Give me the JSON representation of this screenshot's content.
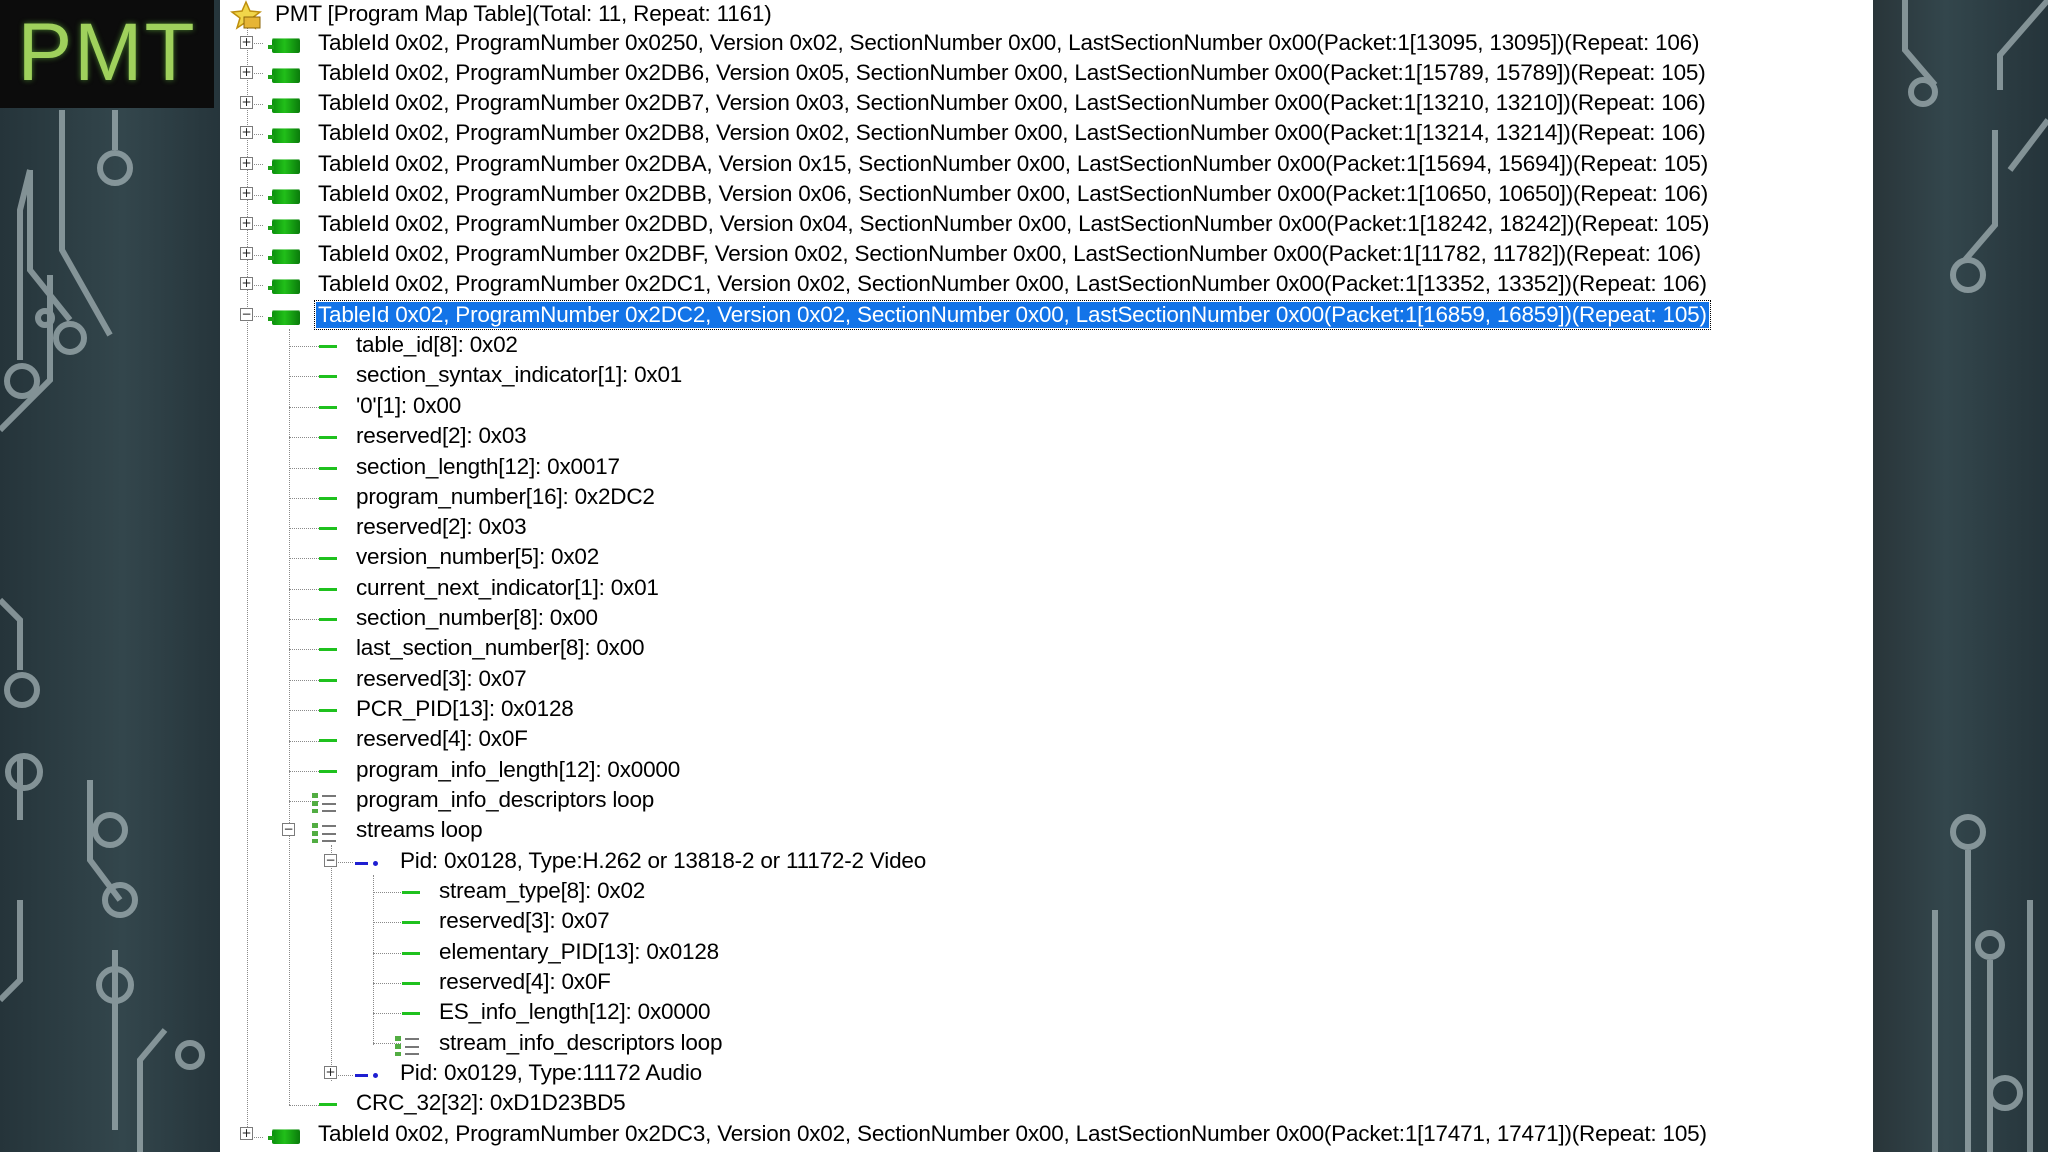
{
  "header": {
    "title": "PMT"
  },
  "tree": {
    "root": {
      "label": "PMT [Program Map Table](Total: 11, Repeat: 1161)",
      "icon": "star-folder-icon"
    },
    "tables": [
      "TableId 0x02, ProgramNumber 0x0250, Version 0x02, SectionNumber 0x00, LastSectionNumber 0x00(Packet:1[13095, 13095])(Repeat: 106)",
      "TableId 0x02, ProgramNumber 0x2DB6, Version 0x05, SectionNumber 0x00, LastSectionNumber 0x00(Packet:1[15789, 15789])(Repeat: 105)",
      "TableId 0x02, ProgramNumber 0x2DB7, Version 0x03, SectionNumber 0x00, LastSectionNumber 0x00(Packet:1[13210, 13210])(Repeat: 106)",
      "TableId 0x02, ProgramNumber 0x2DB8, Version 0x02, SectionNumber 0x00, LastSectionNumber 0x00(Packet:1[13214, 13214])(Repeat: 106)",
      "TableId 0x02, ProgramNumber 0x2DBA, Version 0x15, SectionNumber 0x00, LastSectionNumber 0x00(Packet:1[15694, 15694])(Repeat: 105)",
      "TableId 0x02, ProgramNumber 0x2DBB, Version 0x06, SectionNumber 0x00, LastSectionNumber 0x00(Packet:1[10650, 10650])(Repeat: 106)",
      "TableId 0x02, ProgramNumber 0x2DBD, Version 0x04, SectionNumber 0x00, LastSectionNumber 0x00(Packet:1[18242, 18242])(Repeat: 105)",
      "TableId 0x02, ProgramNumber 0x2DBF, Version 0x02, SectionNumber 0x00, LastSectionNumber 0x00(Packet:1[11782, 11782])(Repeat: 106)",
      "TableId 0x02, ProgramNumber 0x2DC1, Version 0x02, SectionNumber 0x00, LastSectionNumber 0x00(Packet:1[13352, 13352])(Repeat: 106)"
    ],
    "selected_table": {
      "label": "TableId 0x02, ProgramNumber 0x2DC2, Version 0x02, SectionNumber 0x00, LastSectionNumber 0x00(Packet:1[16859, 16859])(Repeat: 105)",
      "fields": [
        "table_id[8]: 0x02",
        "section_syntax_indicator[1]: 0x01",
        "'0'[1]: 0x00",
        "reserved[2]: 0x03",
        "section_length[12]: 0x0017",
        "program_number[16]: 0x2DC2",
        "reserved[2]: 0x03",
        "version_number[5]: 0x02",
        "current_next_indicator[1]: 0x01",
        "section_number[8]: 0x00",
        "last_section_number[8]: 0x00",
        "reserved[3]: 0x07",
        "PCR_PID[13]: 0x0128",
        "reserved[4]: 0x0F",
        "program_info_length[12]: 0x0000"
      ],
      "program_info_loop": "program_info_descriptors loop",
      "streams_loop": "streams loop",
      "stream_video": {
        "label": "Pid: 0x0128, Type:H.262 or 13818-2 or 11172-2 Video",
        "fields": [
          "stream_type[8]: 0x02",
          "reserved[3]: 0x07",
          "elementary_PID[13]: 0x0128",
          "reserved[4]: 0x0F",
          "ES_info_length[12]: 0x0000"
        ],
        "descriptor_loop": "stream_info_descriptors loop"
      },
      "stream_audio": "Pid: 0x0129, Type:11172 Audio",
      "crc": "CRC_32[32]: 0xD1D23BD5"
    },
    "last_table": "TableId 0x02, ProgramNumber 0x2DC3, Version 0x02, SectionNumber 0x00, LastSectionNumber 0x00(Packet:1[17471, 17471])(Repeat: 105)"
  },
  "colors": {
    "title_green": "#9FD15C",
    "selection_blue": "#1374E8",
    "table_icon_green": "#1CA016",
    "stream_icon_blue": "#1F1FD1"
  }
}
